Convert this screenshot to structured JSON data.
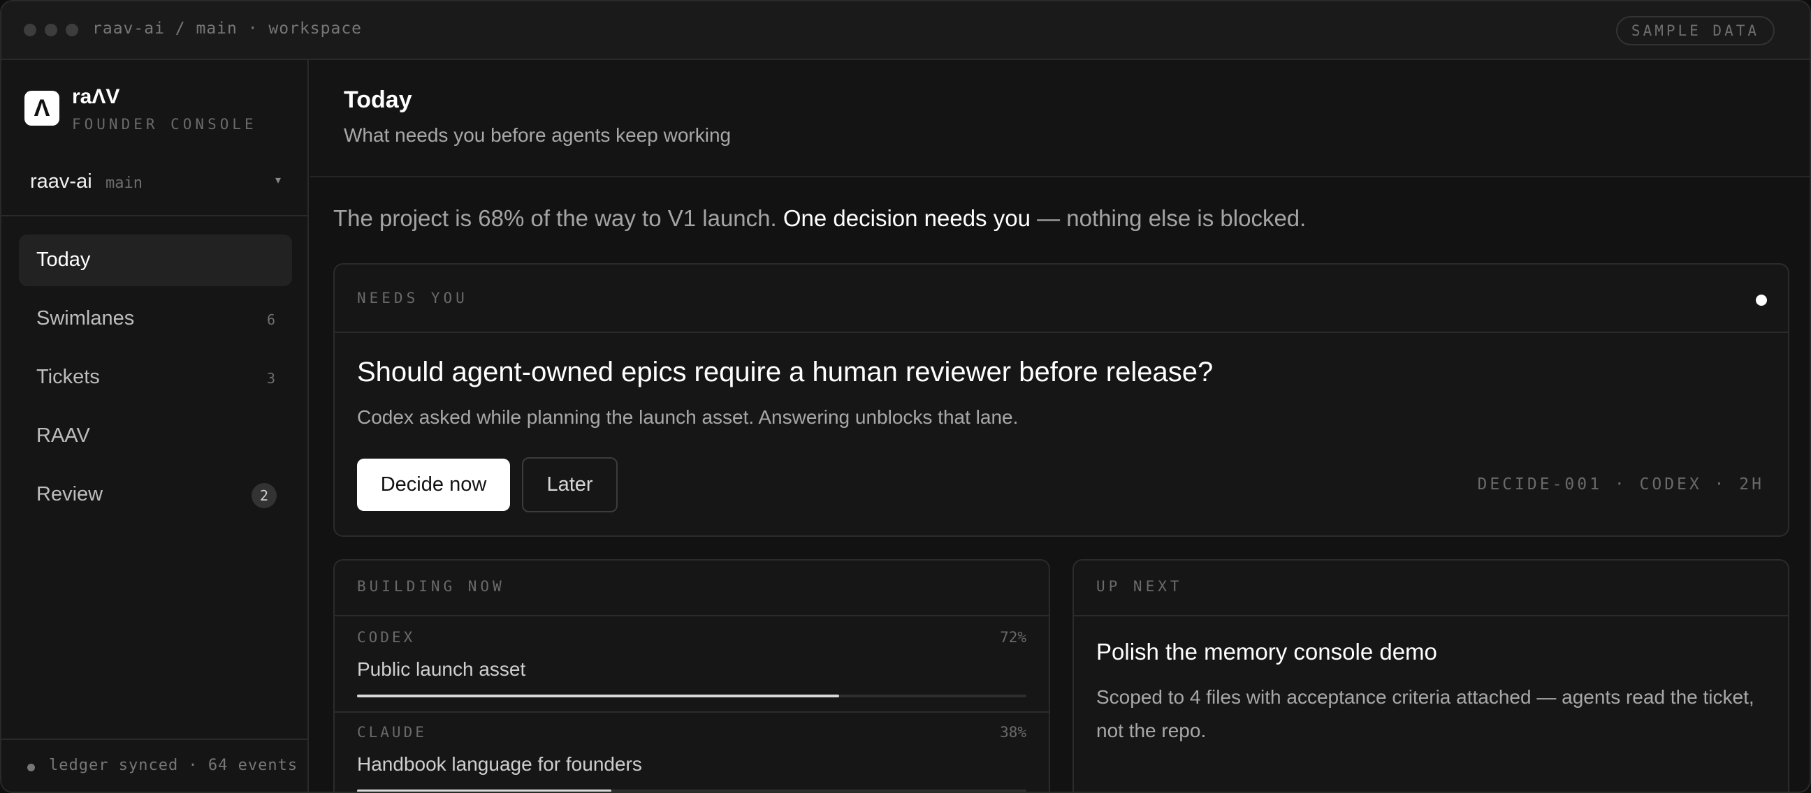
{
  "titlebar": {
    "path": "raav-ai / main · workspace",
    "badge": "SAMPLE DATA"
  },
  "sidebar": {
    "logo_glyph": "Λ",
    "brand": "raΛV",
    "subtitle": "FOUNDER CONSOLE",
    "project": {
      "name": "raav-ai",
      "branch": "main",
      "caret": "▾"
    },
    "items": [
      {
        "label": "Today",
        "count": "",
        "active": true
      },
      {
        "label": "Swimlanes",
        "count": "6"
      },
      {
        "label": "Tickets",
        "count": "3"
      },
      {
        "label": "RAAV",
        "count": ""
      },
      {
        "label": "Review",
        "count": "2"
      }
    ],
    "footer": "ledger synced · 64 events"
  },
  "header": {
    "title": "Today",
    "subtitle": "What needs you before agents keep working"
  },
  "summary": {
    "lead": "The project is 68% of the way to V1 launch. ",
    "strong": "One decision needs you",
    "tail": " — nothing else is blocked."
  },
  "needs_you": {
    "label": "NEEDS YOU",
    "question": "Should agent-owned epics require a human reviewer before release?",
    "description": "Codex asked while planning the launch asset. Answering unblocks that lane.",
    "primary_button": "Decide now",
    "secondary_button": "Later",
    "meta": "DECIDE-001 · CODEX · 2H"
  },
  "building_now": {
    "label": "BUILDING NOW",
    "tasks": [
      {
        "agent": "CODEX",
        "pct": "72%",
        "progress": 0.72,
        "name": "Public launch asset"
      },
      {
        "agent": "CLAUDE",
        "pct": "38%",
        "progress": 0.38,
        "name": "Handbook language for founders"
      }
    ]
  },
  "up_next": {
    "label": "UP NEXT",
    "title": "Polish the memory console demo",
    "description": "Scoped to 4 files with acceptance criteria attached — agents read the ticket, not the repo."
  }
}
